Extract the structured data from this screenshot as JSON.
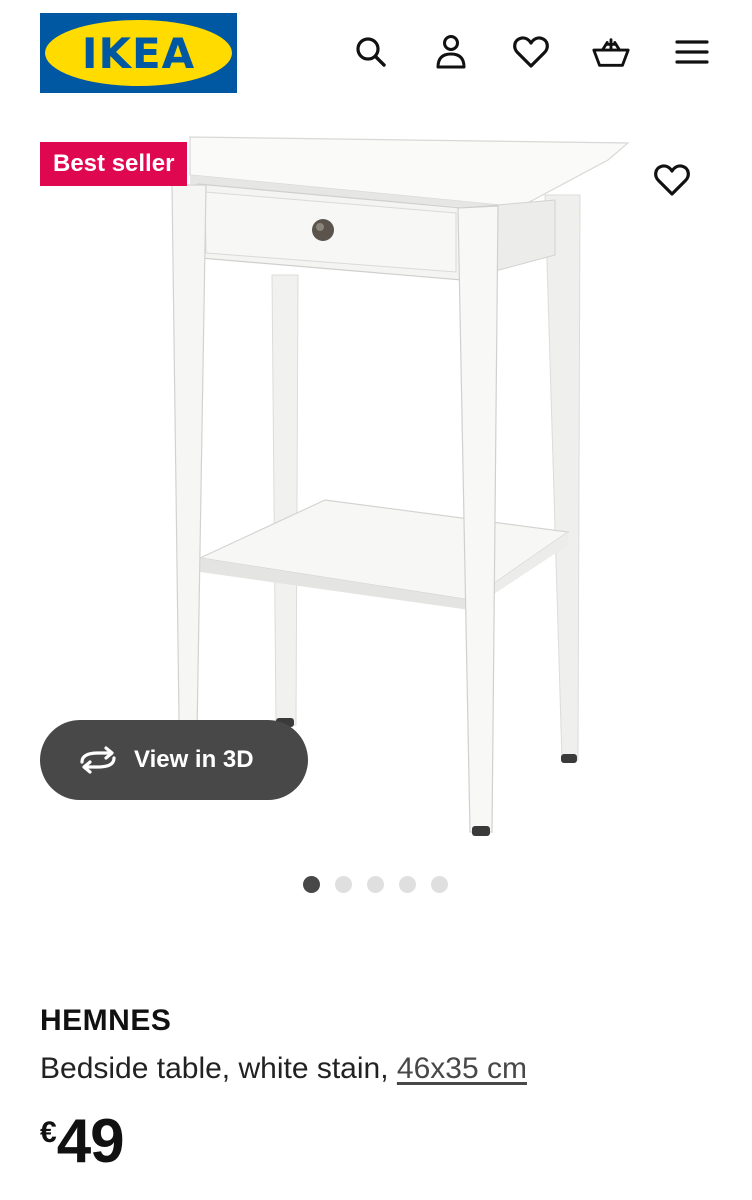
{
  "header": {
    "logo_text": "IKEA",
    "icons": [
      "search-icon",
      "user-icon",
      "heart-icon",
      "basket-icon",
      "menu-icon"
    ]
  },
  "badge": {
    "label": "Best seller"
  },
  "gallery": {
    "view_3d_label": "View in 3D",
    "dots": 5,
    "active_index": 0
  },
  "product": {
    "name": "HEMNES",
    "description": "Bedside table, white stain,",
    "size": "46x35 cm",
    "currency": "€",
    "price": "49"
  },
  "colors": {
    "ikea_blue": "#0058a3",
    "ikea_yellow": "#ffdb00",
    "badge_red": "#e00751",
    "button_dark": "#484848"
  }
}
